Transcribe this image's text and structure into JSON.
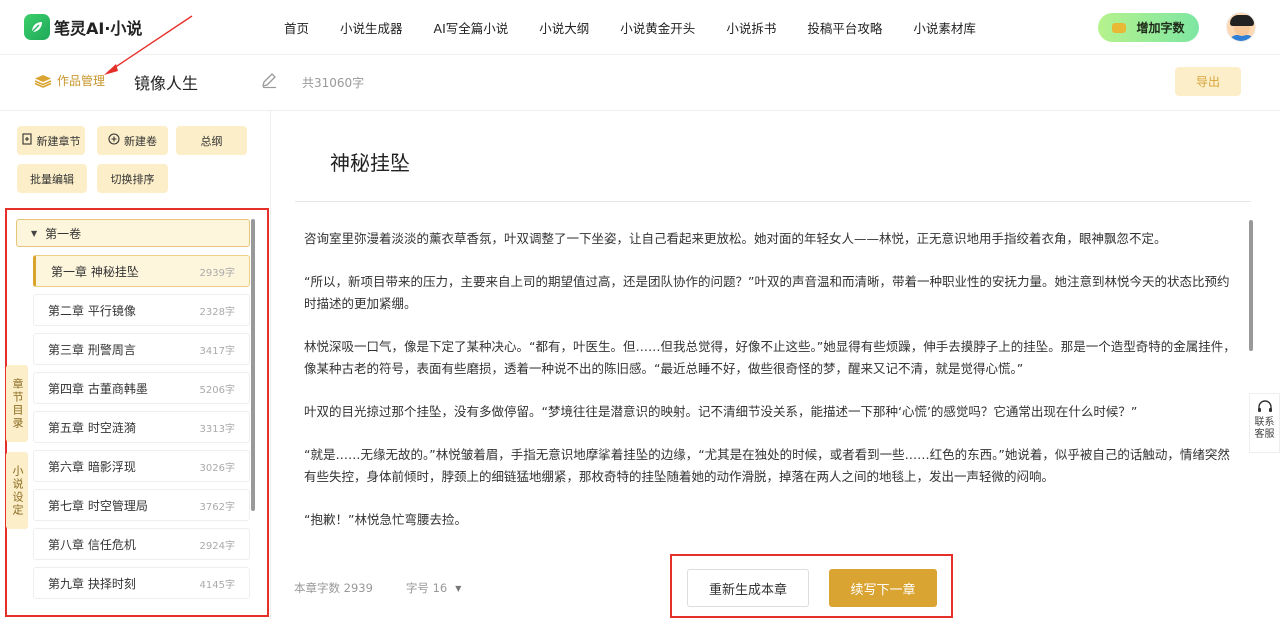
{
  "app": {
    "logo_text": "笔灵AI·小说"
  },
  "nav": {
    "items": [
      "首页",
      "小说生成器",
      "AI写全篇小说",
      "小说大纲",
      "小说黄金开头",
      "小说拆书",
      "投稿平台攻略",
      "小说素材库"
    ],
    "add_words": "增加字数"
  },
  "subheader": {
    "works_manage": "作品管理",
    "work_title": "镜像人生",
    "word_total": "共31060字",
    "export": "导出"
  },
  "toolbar": {
    "new_chapter": "新建章节",
    "new_volume": "新建卷",
    "outline": "总纲",
    "batch_edit": "批量编辑",
    "toggle_sort": "切换排序"
  },
  "toc": {
    "volume": "第一卷",
    "chapters": [
      {
        "name": "第一章 神秘挂坠",
        "count": "2939字"
      },
      {
        "name": "第二章 平行镜像",
        "count": "2328字"
      },
      {
        "name": "第三章 刑警周言",
        "count": "3417字"
      },
      {
        "name": "第四章 古董商韩墨",
        "count": "5206字"
      },
      {
        "name": "第五章 时空涟漪",
        "count": "3313字"
      },
      {
        "name": "第六章 暗影浮现",
        "count": "3026字"
      },
      {
        "name": "第七章 时空管理局",
        "count": "3762字"
      },
      {
        "name": "第八章 信任危机",
        "count": "2924字"
      },
      {
        "name": "第九章 抉择时刻",
        "count": "4145字"
      }
    ]
  },
  "side_tabs": {
    "toc": "章节目录",
    "settings": "小说设定"
  },
  "editor": {
    "chapter_title": "神秘挂坠",
    "paragraphs": [
      "咨询室里弥漫着淡淡的薰衣草香氛，叶双调整了一下坐姿，让自己看起来更放松。她对面的年轻女人——林悦，正无意识地用手指绞着衣角，眼神飘忽不定。",
      "“所以，新项目带来的压力，主要来自上司的期望值过高，还是团队协作的问题？”叶双的声音温和而清晰，带着一种职业性的安抚力量。她注意到林悦今天的状态比预约时描述的更加紧绷。",
      "林悦深吸一口气，像是下定了某种决心。“都有，叶医生。但……但我总觉得，好像不止这些。”她显得有些烦躁，伸手去摸脖子上的挂坠。那是一个造型奇特的金属挂件，像某种古老的符号，表面有些磨损，透着一种说不出的陈旧感。“最近总睡不好，做些很奇怪的梦，醒来又记不清，就是觉得心慌。”",
      "叶双的目光掠过那个挂坠，没有多做停留。“梦境往往是潜意识的映射。记不清细节没关系，能描述一下那种‘心慌’的感觉吗？它通常出现在什么时候？”",
      "“就是……无缘无故的。”林悦皱着眉，手指无意识地摩挲着挂坠的边缘，“尤其是在独处的时候，或者看到一些……红色的东西。”她说着，似乎被自己的话触动，情绪突然有些失控，身体前倾时，脖颈上的细链猛地绷紧，那枚奇特的挂坠随着她的动作滑脱，掉落在两人之间的地毯上，发出一声轻微的闷响。",
      "“抱歉！”林悦急忙弯腰去捡。"
    ],
    "chapter_words": "本章字数 2939",
    "font_size": "字号 16",
    "regenerate": "重新生成本章",
    "continue": "续写下一章"
  },
  "contact": "联系客服",
  "colors": {
    "accent": "#d9a432",
    "accent_light": "#fbeec8",
    "annotation_red": "#e5302a"
  }
}
